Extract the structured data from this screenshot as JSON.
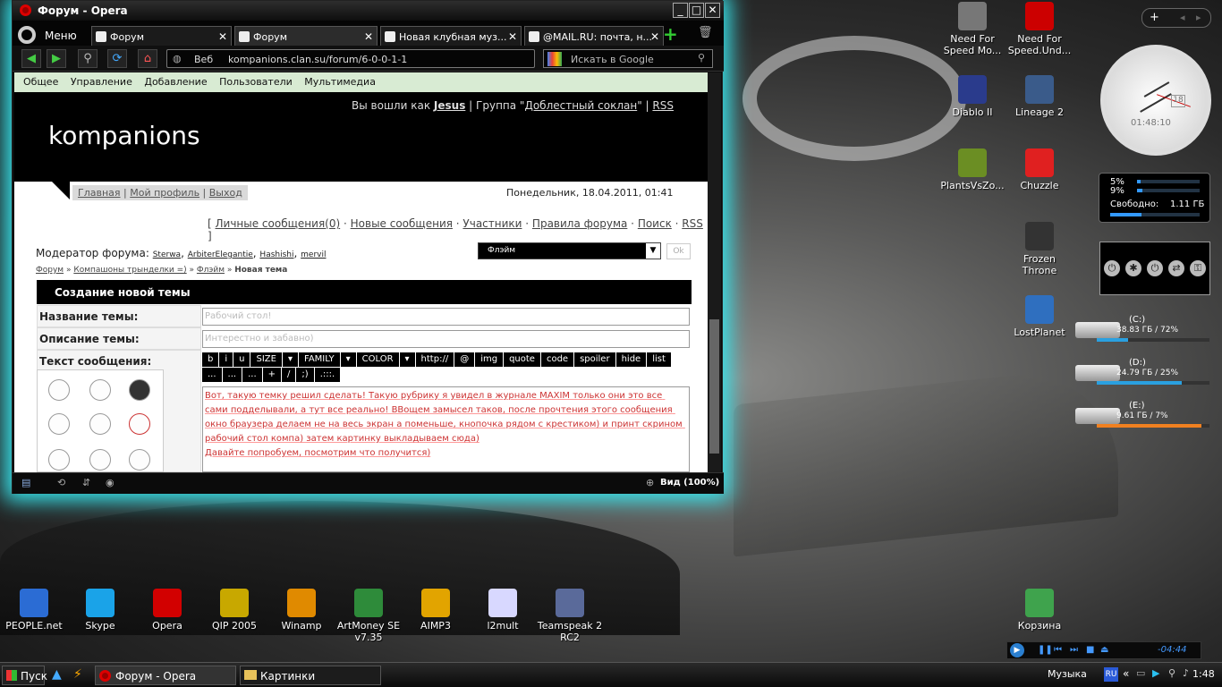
{
  "window": {
    "title": "Форум - Opera",
    "tabs": [
      {
        "label": "Меню"
      },
      {
        "label": "Форум"
      },
      {
        "label": "Форум"
      },
      {
        "label": "Новая клубная муз..."
      },
      {
        "label": "@MAIL.RU: почта, н..."
      }
    ],
    "address_prefix": "Веб",
    "address": "kompanions.clan.su/forum/6-0-0-1-1",
    "search_placeholder": "Искать в Google",
    "zoom_label": "Вид (100%)"
  },
  "page": {
    "top_menu": [
      "Общее",
      "Управление",
      "Добавление",
      "Пользователи",
      "Мультимедиа"
    ],
    "login_prefix": "Вы вошли как",
    "user": "Jesus",
    "group_prefix": "| Группа \"",
    "group": "Доблестный соклан",
    "group_suffix": "\" |",
    "rss": "RSS",
    "site_name": "kompanions",
    "sub_nav": [
      "Главная",
      "Мой профиль",
      "Выход"
    ],
    "date": "Понедельник, 18.04.2011, 01:41",
    "forum_links": [
      "Личные сообщения(0)",
      "Новые сообщения",
      "Участники",
      "Правила форума",
      "Поиск",
      "RSS"
    ],
    "moderator_label": "Модератор форума:",
    "moderators": [
      "Sterwa",
      "ArbiterElegantie",
      "Hashishi",
      "mervil"
    ],
    "forum_select": "Флэйм",
    "ok": "Ok",
    "breadcrumb": [
      "Форум",
      "Компашоны трынделки =)",
      "Флэйм",
      "Новая тема"
    ],
    "form_title": "Создание новой темы",
    "label_topic": "Название темы:",
    "label_desc": "Описание темы:",
    "label_text": "Текст сообщения:",
    "topic_value": "Рабочий стол!",
    "desc_value": "Интерестно и забавно)",
    "bbcodes": [
      "b",
      "i",
      "u",
      "SIZE",
      "▾",
      "FAMILY",
      "▾",
      "COLOR",
      "▾",
      "http://",
      "@",
      "img",
      "quote",
      "code",
      "spoiler",
      "hide",
      "list",
      "...",
      "...",
      "...",
      "+",
      "/",
      ";)",
      ".:::."
    ],
    "message": "Вот, такую темку решил сделать! Такую рубрику я увидел в журнале MAXIM только они это все сами подделывали, а тут все реально! ВВощем замысел таков, после прочтения этого сообщения окно браузера делаем не на весь экран а поменьше, кнопочка рядом с крестиком) и принт скрином рабочий стол компа) затем картинку выкладываем сюда)\nДавайте попробуем, посмотрим что получится)"
  },
  "desktop_icons_right": [
    {
      "label": "Need For Speed Mo...",
      "color": "#777"
    },
    {
      "label": "Need For Speed.Und...",
      "color": "#c00"
    },
    {
      "label": "Diablo II",
      "color": "#2a3b8c"
    },
    {
      "label": "Lineage 2",
      "color": "#3a5b8a"
    },
    {
      "label": "PlantsVsZo...",
      "color": "#6b8e23"
    },
    {
      "label": "Chuzzle",
      "color": "#e02020"
    },
    {
      "label": "Frozen Throne",
      "color": "#333"
    },
    {
      "label": "LostPlanet",
      "color": "#2f6fbf"
    }
  ],
  "desktop_icons_bottom": [
    {
      "label": "PEOPLE.net",
      "color": "#2b6cd4"
    },
    {
      "label": "Skype",
      "color": "#1aa3e8"
    },
    {
      "label": "Opera",
      "color": "#d20000"
    },
    {
      "label": "QIP 2005",
      "color": "#c8a800"
    },
    {
      "label": "Winamp",
      "color": "#e08a00"
    },
    {
      "label": "ArtMoney SE v7.35",
      "color": "#2e8b3a"
    },
    {
      "label": "AIMP3",
      "color": "#e2a400"
    },
    {
      "label": "l2mult",
      "color": "#d8d8ff"
    },
    {
      "label": "Teamspeak 2 RC2",
      "color": "#5a6a9a"
    },
    {
      "label": "Корзина",
      "color": "#3fa34d"
    }
  ],
  "gadgets": {
    "clock_time": "01:48:10",
    "clock_date": "18",
    "cpu1": "5%",
    "cpu2": "9%",
    "free_label": "Свободно:",
    "free_value": "1.11 ГБ",
    "disks": [
      {
        "name": "(C:)",
        "info": "38.83 ГБ / 72%",
        "used": 0.28,
        "color": "#2aa0e0"
      },
      {
        "name": "(D:)",
        "info": "24.79 ГБ / 25%",
        "used": 0.75,
        "color": "#2aa0e0"
      },
      {
        "name": "(E:)",
        "info": "9.61 ГБ / 7%",
        "used": 0.93,
        "color": "#f08020"
      }
    ],
    "player_time": "-04:44"
  },
  "taskbar": {
    "start": "Пуск",
    "tasks": [
      "Форум - Opera",
      "Картинки"
    ],
    "music": "Музыка",
    "lang": "RU",
    "time": "1:48"
  }
}
